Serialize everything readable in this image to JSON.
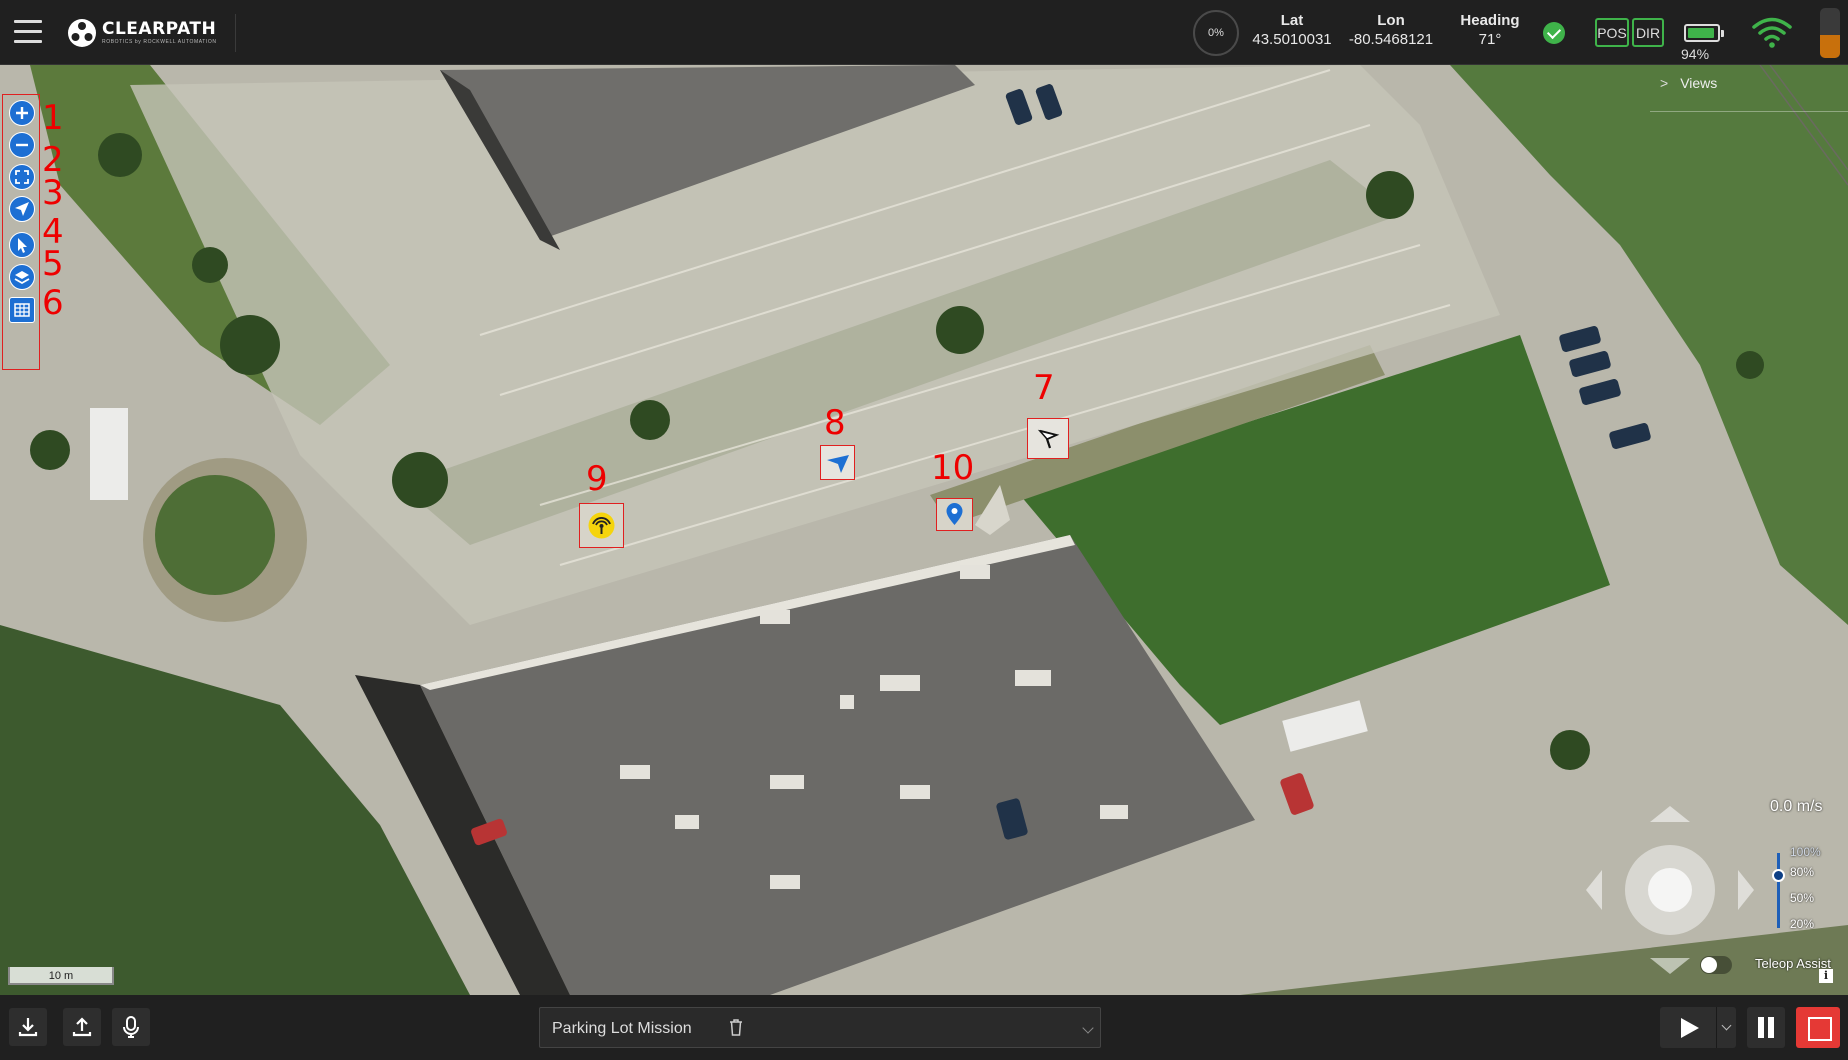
{
  "app": {
    "logo_text": "CLEARPATH",
    "logo_sub": "ROBOTICS  by ROCKWELL AUTOMATION"
  },
  "header": {
    "progress": "0%",
    "lat_label": "Lat",
    "lat_value": "43.5010031",
    "lon_label": "Lon",
    "lon_value": "-80.5468121",
    "heading_label": "Heading",
    "heading_value": "71°",
    "pos_label": "POS",
    "dir_label": "DIR",
    "battery_pct": "94%",
    "battery_level": 0.94,
    "side_gauge_level": 0.46,
    "icons": [
      "menu-icon",
      "check-icon",
      "wifi-icon",
      "battery-icon"
    ]
  },
  "map": {
    "views_label": "Views",
    "scale_label": "10 m",
    "tools": [
      {
        "name": "zoom-in",
        "number": "1"
      },
      {
        "name": "zoom-out",
        "number": "2"
      },
      {
        "name": "fit-view",
        "number": "3"
      },
      {
        "name": "locate-robot",
        "number": "4"
      },
      {
        "name": "select-pointer",
        "number": "5"
      },
      {
        "name": "layers",
        "number": "6"
      },
      {
        "name": "grid"
      }
    ],
    "markers": [
      {
        "name": "waypoint-flag-marker",
        "number": "7"
      },
      {
        "name": "robot-heading-marker",
        "number": "8"
      },
      {
        "name": "base-station-marker",
        "number": "9"
      },
      {
        "name": "location-pin-marker",
        "number": "10"
      }
    ]
  },
  "teleop": {
    "speed": "0.0 m/s",
    "ticks": [
      "100%",
      "80%",
      "50%",
      "20%"
    ],
    "selected_tick": "80%",
    "assist_label": "Teleop Assist",
    "assist_on": false
  },
  "footer": {
    "mission_name": "Parking Lot Mission",
    "buttons": [
      "download-icon",
      "upload-icon",
      "microphone-icon",
      "play-icon",
      "pause-icon",
      "stop-icon"
    ]
  },
  "colors": {
    "accent": "#1d6fd3",
    "ok": "#3fb34a",
    "stop": "#e53935",
    "annotation": "#e02020"
  }
}
